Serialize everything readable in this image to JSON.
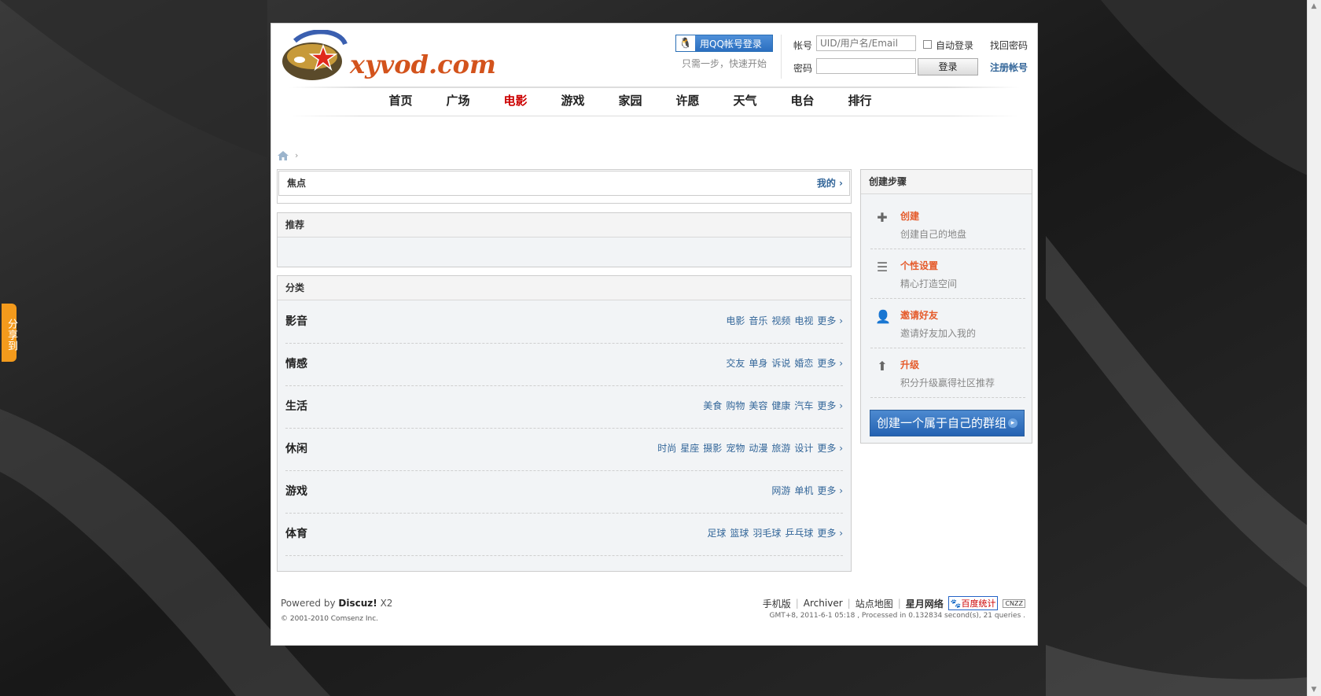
{
  "header": {
    "logo_text": "xyvod.com",
    "qq_login_label": "用QQ帐号登录",
    "qq_sub": "只需一步，快速开始",
    "account_label": "帐号",
    "account_placeholder": "UID/用户名/Email",
    "auto_login_label": "自动登录",
    "forgot_password": "找回密码",
    "password_label": "密码",
    "login_button": "登录",
    "register": "注册帐号"
  },
  "nav": {
    "items": [
      "首页",
      "广场",
      "电影",
      "游戏",
      "家园",
      "许愿",
      "天气",
      "电台",
      "排行"
    ],
    "active": "电影"
  },
  "share": "分享到",
  "breadcrumb": {
    "separator": "›"
  },
  "focus": {
    "title": "焦点",
    "more": "我的 ›"
  },
  "recommend": {
    "title": "推荐"
  },
  "category": {
    "title": "分类",
    "rows": [
      {
        "name": "影音",
        "links": [
          "电影",
          "音乐",
          "视频",
          "电视",
          "更多 ›"
        ]
      },
      {
        "name": "情感",
        "links": [
          "交友",
          "单身",
          "诉说",
          "婚恋",
          "更多 ›"
        ]
      },
      {
        "name": "生活",
        "links": [
          "美食",
          "购物",
          "美容",
          "健康",
          "汽车",
          "更多 ›"
        ]
      },
      {
        "name": "休闲",
        "links": [
          "时尚",
          "星座",
          "摄影",
          "宠物",
          "动漫",
          "旅游",
          "设计",
          "更多 ›"
        ]
      },
      {
        "name": "游戏",
        "links": [
          "网游",
          "单机",
          "更多 ›"
        ]
      },
      {
        "name": "体育",
        "links": [
          "足球",
          "篮球",
          "羽毛球",
          "乒乓球",
          "更多 ›"
        ]
      }
    ]
  },
  "sidebar": {
    "title": "创建步骤",
    "steps": [
      {
        "title": "创建",
        "desc": "创建自己的地盘",
        "icon": "plus-icon"
      },
      {
        "title": "个性设置",
        "desc": "精心打造空间",
        "icon": "list-icon"
      },
      {
        "title": "邀请好友",
        "desc": "邀请好友加入我的",
        "icon": "user-icon"
      },
      {
        "title": "升级",
        "desc": "积分升级赢得社区推荐",
        "icon": "up-arrow-icon"
      }
    ],
    "create_button": "创建一个属于自己的群组"
  },
  "footer": {
    "powered_prefix": "Powered by",
    "powered_brand": "Discuz!",
    "powered_version": "X2",
    "copyright": "© 2001-2010 Comsenz Inc.",
    "links": [
      "手机版",
      "Archiver",
      "站点地图",
      "星月网络"
    ],
    "baidu": "百度统计",
    "cnzz": "CNZZ",
    "gmt": "GMT+8, 2011-6-1 05:18 , Processed in 0.132834 second(s), 21 queries ."
  },
  "colors": {
    "accent_red": "#cc0000",
    "link_blue": "#336699",
    "step_orange": "#e55b2b",
    "button_blue": "#2462b2"
  }
}
